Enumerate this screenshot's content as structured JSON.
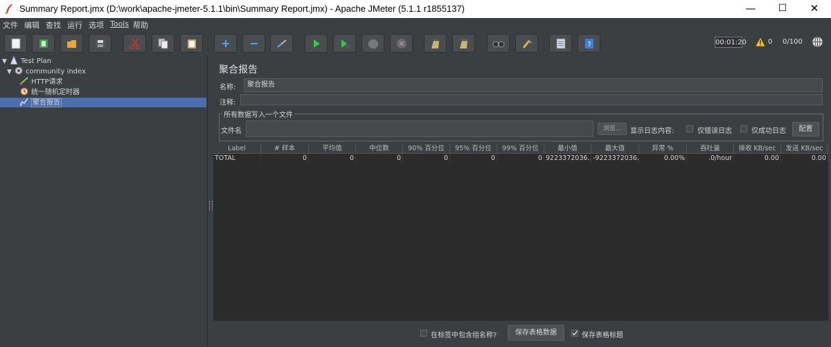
{
  "window": {
    "title": "Summary Report.jmx (D:\\work\\apache-jmeter-5.1.1\\bin\\Summary Report.jmx) - Apache JMeter (5.1.1 r1855137)",
    "min_glyph": "—",
    "max_glyph": "☐",
    "close_glyph": "✕"
  },
  "menu": [
    "文件",
    "编辑",
    "查找",
    "运行",
    "选项",
    "Tools",
    "帮助"
  ],
  "toolbar": {
    "buttons": [
      "new-icon",
      "templates-icon",
      "open-icon",
      "save-icon",
      "cut-icon",
      "copy-icon",
      "paste-icon",
      "expand-icon",
      "collapse-icon",
      "toggle-icon",
      "start-icon",
      "start-no-pause-icon",
      "stop-icon",
      "shutdown-icon",
      "clear-icon",
      "clear-all-icon",
      "search-icon",
      "reset-search-icon",
      "function-helper-icon",
      "help-icon"
    ],
    "elapsed": "00:01:20",
    "warnings": "0",
    "threads": "0/100"
  },
  "tree": {
    "nodes": [
      {
        "label": "Test Plan",
        "icon": "test-plan-icon"
      },
      {
        "label": "community index",
        "icon": "thread-group-icon"
      },
      {
        "label": "HTTP请求",
        "icon": "http-sampler-icon"
      },
      {
        "label": "统一随机定时器",
        "icon": "timer-icon"
      },
      {
        "label": "聚合报告",
        "icon": "listener-icon"
      }
    ]
  },
  "report": {
    "heading": "聚合报告",
    "name_label": "名称:",
    "name_value": "聚合报告",
    "comment_label": "注释:",
    "comment_value": "",
    "file_group_legend": "所有数据写入一个文件",
    "file_label": "文件名",
    "file_value": "",
    "browse_label": "浏览...",
    "log_content_label": "显示日志内容:",
    "errors_only_label": "仅错误日志",
    "success_only_label": "仅成功日志",
    "configure_label": "配置"
  },
  "table": {
    "columns": [
      "Label",
      "# 样本",
      "平均值",
      "中位数",
      "90% 百分位",
      "95% 百分位",
      "99% 百分位",
      "最小值",
      "最大值",
      "异常 %",
      "吞吐量",
      "接收 KB/sec",
      "发送 KB/sec"
    ],
    "rows": [
      [
        "TOTAL",
        "0",
        "0",
        "0",
        "0",
        "0",
        "0",
        "9223372036...",
        "-9223372036...",
        "0.00%",
        ".0/hour",
        "0.00",
        "0.00"
      ]
    ]
  },
  "bottom": {
    "include_group_label": "在标签中包含组名称?",
    "include_group_checked": false,
    "save_data_label": "保存表格数据",
    "save_header_label": "保存表格标题",
    "save_header_checked": true
  },
  "colors": {
    "background": "#3c3f41",
    "table_background": "#2b2b2b",
    "selection": "#4b6eaf"
  }
}
